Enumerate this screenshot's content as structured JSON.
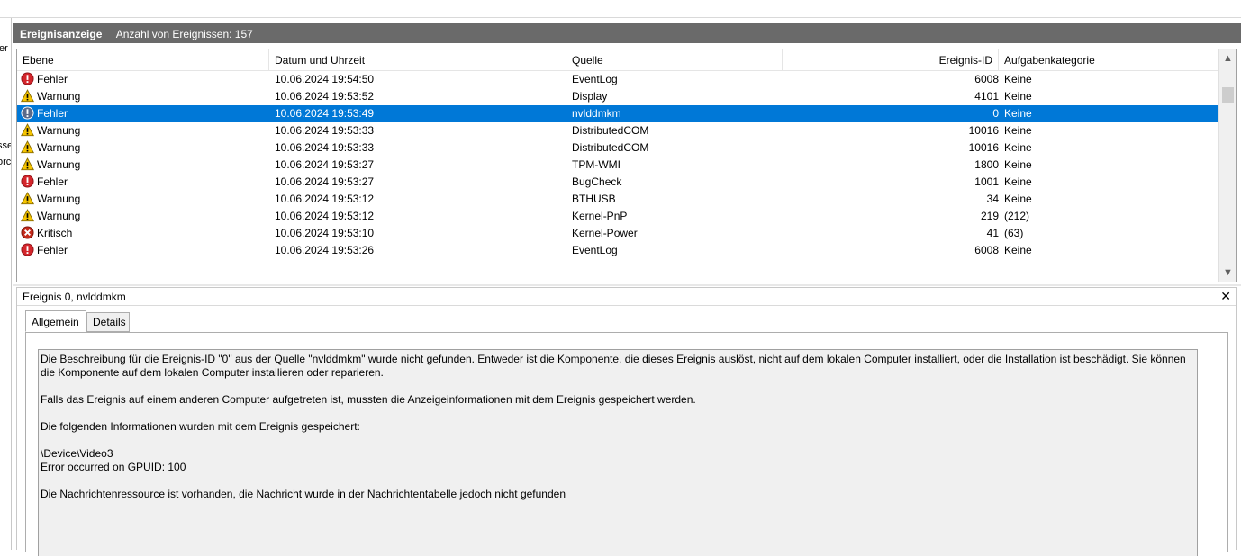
{
  "left_pane": {
    "frag1": "er",
    "frag2": "sse",
    "frag3": "orc"
  },
  "header": {
    "title": "Ereignisanzeige",
    "count_label": "Anzahl von Ereignissen: 157"
  },
  "columns": [
    "Ebene",
    "Datum und Uhrzeit",
    "Quelle",
    "Ereignis-ID",
    "Aufgabenkategorie"
  ],
  "events": [
    {
      "level": "Fehler",
      "icon": "error-icon",
      "date": "10.06.2024 19:54:50",
      "source": "EventLog",
      "id": "6008",
      "category": "Keine"
    },
    {
      "level": "Warnung",
      "icon": "warning-icon",
      "date": "10.06.2024 19:53:52",
      "source": "Display",
      "id": "4101",
      "category": "Keine"
    },
    {
      "level": "Fehler",
      "icon": "error-icon",
      "date": "10.06.2024 19:53:49",
      "source": "nvlddmkm",
      "id": "0",
      "category": "Keine",
      "selected": true
    },
    {
      "level": "Warnung",
      "icon": "warning-icon",
      "date": "10.06.2024 19:53:33",
      "source": "DistributedCOM",
      "id": "10016",
      "category": "Keine"
    },
    {
      "level": "Warnung",
      "icon": "warning-icon",
      "date": "10.06.2024 19:53:33",
      "source": "DistributedCOM",
      "id": "10016",
      "category": "Keine"
    },
    {
      "level": "Warnung",
      "icon": "warning-icon",
      "date": "10.06.2024 19:53:27",
      "source": "TPM-WMI",
      "id": "1800",
      "category": "Keine"
    },
    {
      "level": "Fehler",
      "icon": "error-icon",
      "date": "10.06.2024 19:53:27",
      "source": "BugCheck",
      "id": "1001",
      "category": "Keine"
    },
    {
      "level": "Warnung",
      "icon": "warning-icon",
      "date": "10.06.2024 19:53:12",
      "source": "BTHUSB",
      "id": "34",
      "category": "Keine"
    },
    {
      "level": "Warnung",
      "icon": "warning-icon",
      "date": "10.06.2024 19:53:12",
      "source": "Kernel-PnP",
      "id": "219",
      "category": "(212)"
    },
    {
      "level": "Kritisch",
      "icon": "critical-icon",
      "date": "10.06.2024 19:53:10",
      "source": "Kernel-Power",
      "id": "41",
      "category": "(63)"
    },
    {
      "level": "Fehler",
      "icon": "error-icon",
      "date": "10.06.2024 19:53:26",
      "source": "EventLog",
      "id": "6008",
      "category": "Keine"
    }
  ],
  "detail": {
    "title": "Ereignis 0, nvlddmkm",
    "close": "✕",
    "tabs": [
      "Allgemein",
      "Details"
    ],
    "active_tab": "Allgemein",
    "message": {
      "p1": "Die Beschreibung für die Ereignis-ID \"0\" aus der Quelle \"nvlddmkm\" wurde nicht gefunden. Entweder ist die Komponente, die dieses Ereignis auslöst, nicht auf dem lokalen Computer installiert, oder die Installation ist beschädigt. Sie können die Komponente auf dem lokalen Computer installieren oder reparieren.",
      "p2": "Falls das Ereignis auf einem anderen Computer aufgetreten ist, mussten die Anzeigeinformationen mit dem Ereignis gespeichert werden.",
      "p3": "Die folgenden Informationen wurden mit dem Ereignis gespeichert:",
      "line1": "\\Device\\Video3",
      "line2": "Error occurred on GPUID: 100",
      "p4": "Die Nachrichtenressource ist vorhanden, die Nachricht wurde in der Nachrichtentabelle jedoch nicht gefunden"
    }
  },
  "colors": {
    "selection": "#0078d7",
    "header_bar": "#6a6a6a",
    "message_bg": "#f0f0f0"
  }
}
